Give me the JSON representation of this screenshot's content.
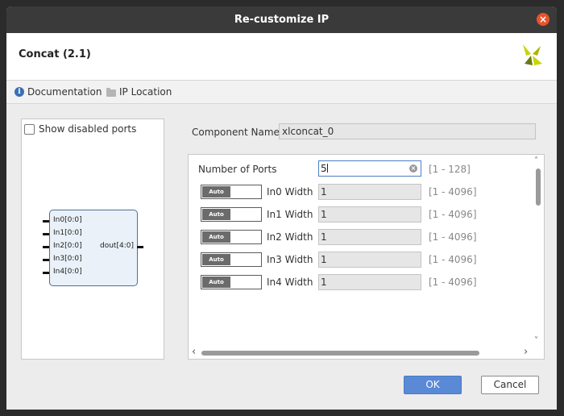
{
  "window": {
    "title": "Re-customize IP",
    "close_glyph": "×"
  },
  "header": {
    "ip_title": "Concat (2.1)"
  },
  "links": {
    "documentation": "Documentation",
    "ip_location": "IP Location",
    "info_glyph": "i"
  },
  "symbol": {
    "show_disabled_label": "Show disabled ports",
    "inputs": [
      "In0[0:0]",
      "In1[0:0]",
      "In2[0:0]",
      "In3[0:0]",
      "In4[0:0]"
    ],
    "output": "dout[4:0]"
  },
  "component": {
    "label": "Component Name",
    "value": "xlconcat_0"
  },
  "params": {
    "num_ports": {
      "label": "Number of Ports",
      "value": "5",
      "range": "[1 - 128]",
      "clear_glyph": "×"
    },
    "auto_label": "Auto",
    "widths": [
      {
        "label": "In0 Width",
        "value": "1",
        "range": "[1 - 4096]"
      },
      {
        "label": "In1 Width",
        "value": "1",
        "range": "[1 - 4096]"
      },
      {
        "label": "In2 Width",
        "value": "1",
        "range": "[1 - 4096]"
      },
      {
        "label": "In3 Width",
        "value": "1",
        "range": "[1 - 4096]"
      },
      {
        "label": "In4 Width",
        "value": "1",
        "range": "[1 - 4096]"
      }
    ]
  },
  "scroll": {
    "up": "˄",
    "down": "˅",
    "left": "‹",
    "right": "›"
  },
  "buttons": {
    "ok": "OK",
    "cancel": "Cancel"
  },
  "colors": {
    "titlebar": "#3a3a3a",
    "primary": "#5a89d6",
    "close": "#e9542b",
    "logo_yellow": "#c8d400",
    "logo_dark": "#6a7a12"
  },
  "icons": [
    "close-icon",
    "xilinx-logo",
    "info-icon",
    "folder-icon",
    "clear-icon"
  ]
}
